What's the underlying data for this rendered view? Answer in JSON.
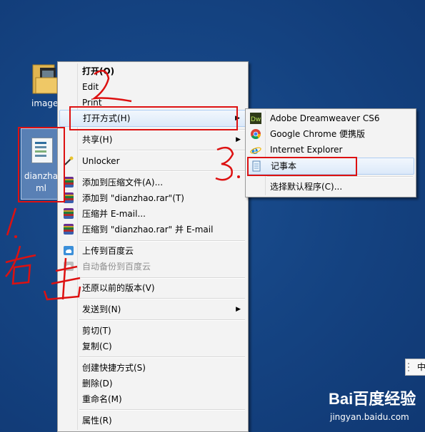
{
  "desktop": {
    "folder_label": "images",
    "file_label_line1": "dianzha",
    "file_label_line2": "ml"
  },
  "context_menu": {
    "items": [
      {
        "label": "打开(O)",
        "bold": true
      },
      {
        "label": "Edit"
      },
      {
        "label": "Print"
      },
      {
        "label": "打开方式(H)",
        "submenu": true
      },
      {
        "label": "共享(H)",
        "submenu": true
      },
      {
        "label": "Unlocker",
        "icon": "unlocker-wand-icon"
      },
      {
        "label": "添加到压缩文件(A)...",
        "icon": "winrar-icon"
      },
      {
        "label": "添加到 \"dianzhao.rar\"(T)",
        "icon": "winrar-icon"
      },
      {
        "label": "压缩并 E-mail...",
        "icon": "winrar-icon"
      },
      {
        "label": "压缩到 \"dianzhao.rar\" 并 E-mail",
        "icon": "winrar-icon"
      },
      {
        "label": "上传到百度云",
        "icon": "baidu-cloud-icon"
      },
      {
        "label": "自动备份到百度云",
        "icon": "baidu-cloud-icon",
        "disabled": true
      },
      {
        "label": "还原以前的版本(V)"
      },
      {
        "label": "发送到(N)",
        "submenu": true
      },
      {
        "label": "剪切(T)"
      },
      {
        "label": "复制(C)"
      },
      {
        "label": "创建快捷方式(S)"
      },
      {
        "label": "删除(D)"
      },
      {
        "label": "重命名(M)"
      },
      {
        "label": "属性(R)"
      }
    ]
  },
  "open_with_submenu": {
    "items": [
      {
        "label": "Adobe Dreamweaver CS6",
        "icon": "dreamweaver-icon"
      },
      {
        "label": "Google Chrome 便携版",
        "icon": "chrome-icon"
      },
      {
        "label": "Internet Explorer",
        "icon": "internet-explorer-icon"
      },
      {
        "label": "记事本",
        "icon": "notepad-icon",
        "highlighted": true
      },
      {
        "label": "选择默认程序(C)..."
      }
    ]
  },
  "annotations": {
    "step1": "1.右击",
    "step2": "2",
    "step3": "3."
  },
  "ime": {
    "label": "中"
  },
  "watermark": {
    "brand": "Bai百度经验",
    "url": "jingyan.baidu.com"
  },
  "colors": {
    "annotation_red": "#dd1111",
    "desktop_blue": "#154483",
    "menu_bg": "#f3f3f3"
  }
}
